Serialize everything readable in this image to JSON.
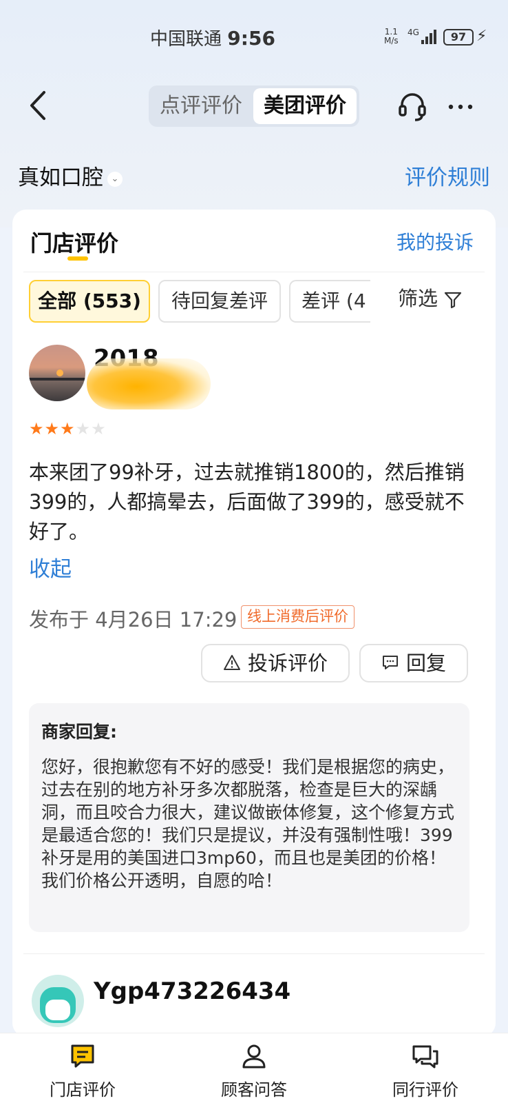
{
  "status": {
    "carrier": "中国联通",
    "time": "9:56",
    "speed_value": "1.1",
    "speed_unit": "M/s",
    "network": "4G",
    "battery": "97"
  },
  "header": {
    "tabs": [
      {
        "label": "点评评价"
      },
      {
        "label": "美团评价"
      }
    ],
    "active_tab": "美团评价"
  },
  "shop": {
    "name": "真如口腔",
    "rules_link": "评价规则"
  },
  "card": {
    "title": "门店评价",
    "complain_link": "我的投诉",
    "chips": [
      {
        "label": "全部 (553)"
      },
      {
        "label": "待回复差评"
      },
      {
        "label": "差评 (4"
      }
    ],
    "filter_label": "筛选",
    "review": {
      "user_name": "2018",
      "rating": 3,
      "max_rating": 5,
      "text": "本来团了99补牙，过去就推销1800的，然后推销399的，人都搞晕去，后面做了399的，感受就不好了。",
      "collapse_label": "收起",
      "publish_time": "发布于 4月26日 17:29",
      "tag": "线上消费后评价",
      "complain_button": "投诉评价",
      "reply_button": "回复",
      "merchant_reply_title": "商家回复:",
      "merchant_reply_text": "您好，很抱歉您有不好的感受！我们是根据您的病史，过去在别的地方补牙多次都脱落，检查是巨大的深龋洞，而且咬合力很大，建议做嵌体修复，这个修复方式是最适合您的！我们只是提议，并没有强制性哦！399补牙是用的美国进口3mp60，而且也是美团的价格！\n我们价格公开透明，自愿的哈！"
    },
    "next_review": {
      "user_name": "Ygp473226434"
    }
  },
  "bottom_nav": [
    {
      "label": "门店评价",
      "icon": "message-icon"
    },
    {
      "label": "顾客问答",
      "icon": "person-icon"
    },
    {
      "label": "同行评价",
      "icon": "chat-bubbles-icon"
    }
  ],
  "colors": {
    "accent_blue": "#2f7fd6",
    "brand_yellow": "#ffc300",
    "star_orange": "#ff7a1a",
    "tag_orange": "#f06a2a"
  }
}
